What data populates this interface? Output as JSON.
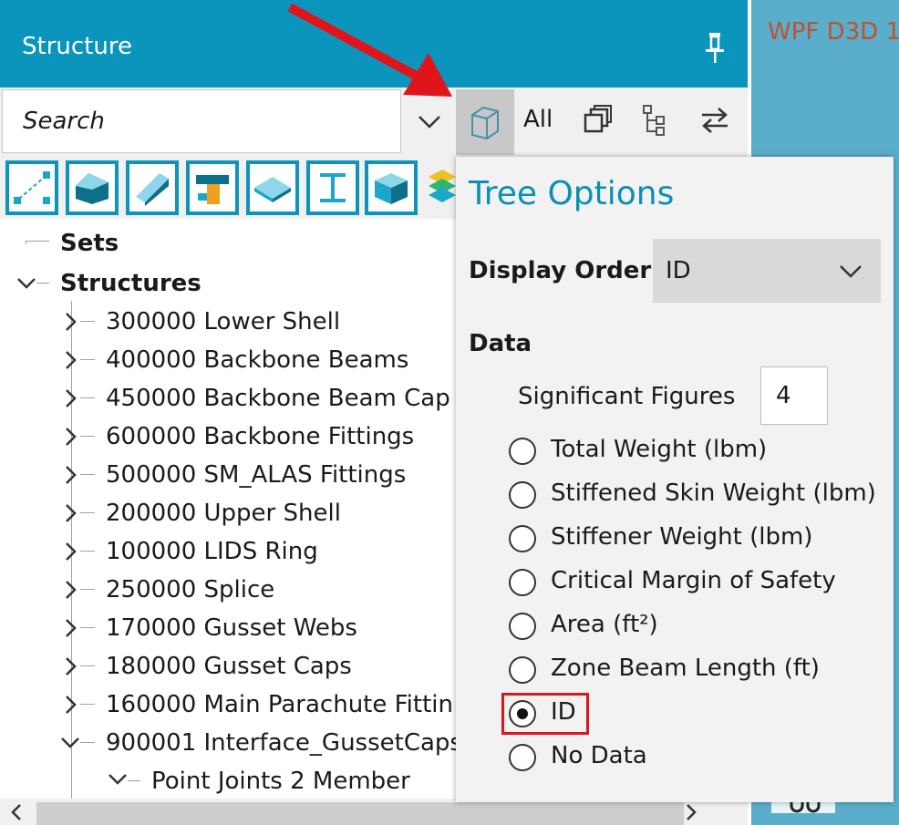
{
  "panel": {
    "title": "Structure"
  },
  "right_pane": {
    "title": "WPF D3D 1"
  },
  "search": {
    "placeholder": "Search"
  },
  "toolbar": {
    "all_label": "All"
  },
  "type_buttons": [
    {
      "name": "nodes-icon",
      "color": "#1aa7c9"
    },
    {
      "name": "skin-icon",
      "color": "#0e6f8a"
    },
    {
      "name": "stiffener-icon",
      "color": "#1aa7c9"
    },
    {
      "name": "fitting-icon",
      "color": "#f0a020"
    },
    {
      "name": "plate-icon",
      "color": "#8ed6ea"
    },
    {
      "name": "beam-icon",
      "color": "#1aa7c9"
    },
    {
      "name": "solid-icon",
      "color": "#0e6f8a"
    }
  ],
  "tree": {
    "sets_label": "Sets",
    "structures_label": "Structures",
    "items": [
      {
        "label": "300000 Lower Shell",
        "expanded": false
      },
      {
        "label": "400000 Backbone Beams",
        "expanded": false
      },
      {
        "label": "450000 Backbone Beam Cap",
        "expanded": false
      },
      {
        "label": "600000 Backbone Fittings",
        "expanded": false
      },
      {
        "label": "500000 SM_ALAS Fittings",
        "expanded": false
      },
      {
        "label": "200000 Upper Shell",
        "expanded": false
      },
      {
        "label": "100000 LIDS Ring",
        "expanded": false
      },
      {
        "label": "250000 Splice",
        "expanded": false
      },
      {
        "label": "170000 Gusset Webs",
        "expanded": false
      },
      {
        "label": "180000 Gusset Caps",
        "expanded": false
      },
      {
        "label": "160000 Main Parachute Fittin",
        "expanded": false
      },
      {
        "label": "900001 Interface_GussetCaps",
        "expanded": true
      }
    ],
    "child": {
      "label": "Point Joints 2 Member"
    }
  },
  "tree_options": {
    "title": "Tree Options",
    "display_order_label": "Display Order:",
    "display_order_value": "ID",
    "data_label": "Data",
    "sig_figs_label": "Significant Figures",
    "sig_figs_value": "4",
    "options": [
      {
        "label": "Total Weight (lbm)",
        "selected": false
      },
      {
        "label": "Stiffened Skin Weight (lbm)",
        "selected": false
      },
      {
        "label": "Stiffener Weight (lbm)",
        "selected": false
      },
      {
        "label": "Critical Margin of Safety",
        "selected": false
      },
      {
        "label": "Area (ft²)",
        "selected": false
      },
      {
        "label": "Zone Beam Length (ft)",
        "selected": false
      },
      {
        "label": "ID",
        "selected": true
      },
      {
        "label": "No Data",
        "selected": false
      }
    ]
  },
  "colors": {
    "accent": "#0b95bd",
    "annotation": "#e0151b"
  }
}
